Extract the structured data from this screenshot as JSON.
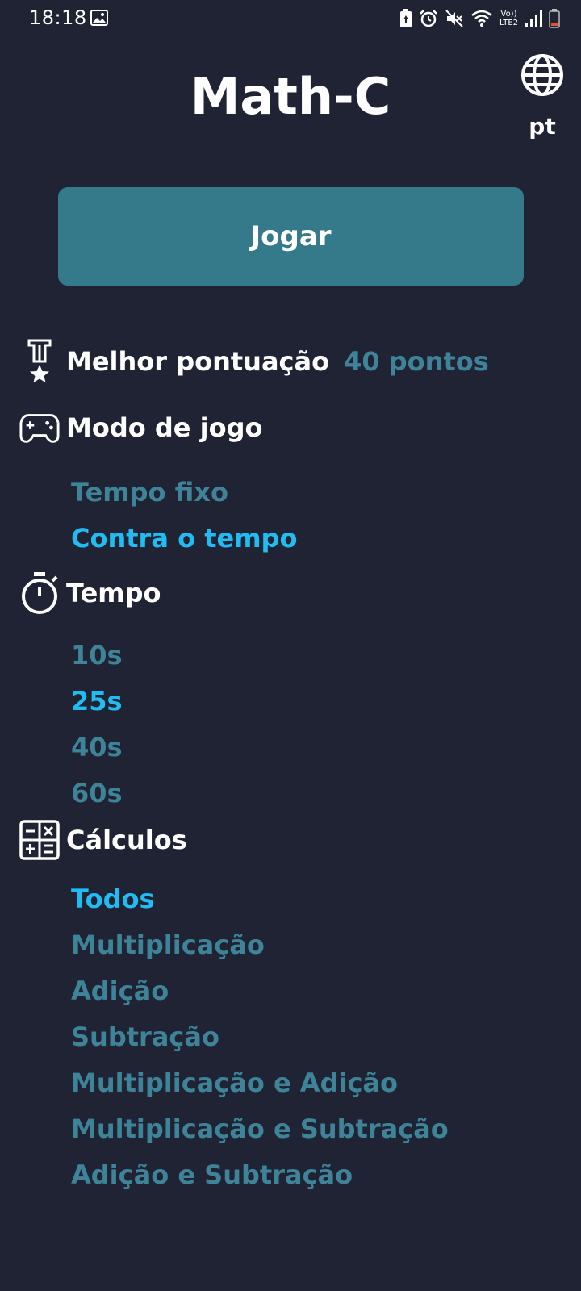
{
  "status_bar": {
    "time": "18:18",
    "network_top": "Vo))",
    "network_bottom": "LTE2"
  },
  "header": {
    "title": "Math-C",
    "language": "pt"
  },
  "play_button": {
    "label": "Jogar"
  },
  "best_score": {
    "label": "Melhor pontuação",
    "value": "40 pontos"
  },
  "game_mode": {
    "title": "Modo de jogo",
    "options": [
      "Tempo fixo",
      "Contra o tempo"
    ],
    "selected_index": 1
  },
  "time": {
    "title": "Tempo",
    "options": [
      "10s",
      "25s",
      "40s",
      "60s"
    ],
    "selected_index": 1
  },
  "calculations": {
    "title": "Cálculos",
    "options": [
      "Todos",
      "Multiplicação",
      "Adição",
      "Subtração",
      "Multiplicação e Adição",
      "Multiplicação e Subtração",
      "Adição e Subtração"
    ],
    "selected_index": 0
  },
  "colors": {
    "background": "#1f2333",
    "button": "#357a8b",
    "option_inactive": "#3f8399",
    "option_selected": "#21bdf2"
  },
  "icons": {
    "status": [
      "gallery-icon",
      "battery-saver-icon",
      "alarm-icon",
      "mute-icon",
      "wifi-icon",
      "signal-icon",
      "battery-icon"
    ],
    "language": "globe-icon",
    "best_score": "medal-icon",
    "game_mode": "gamepad-icon",
    "time": "stopwatch-icon",
    "calculations": "calculator-icon"
  }
}
